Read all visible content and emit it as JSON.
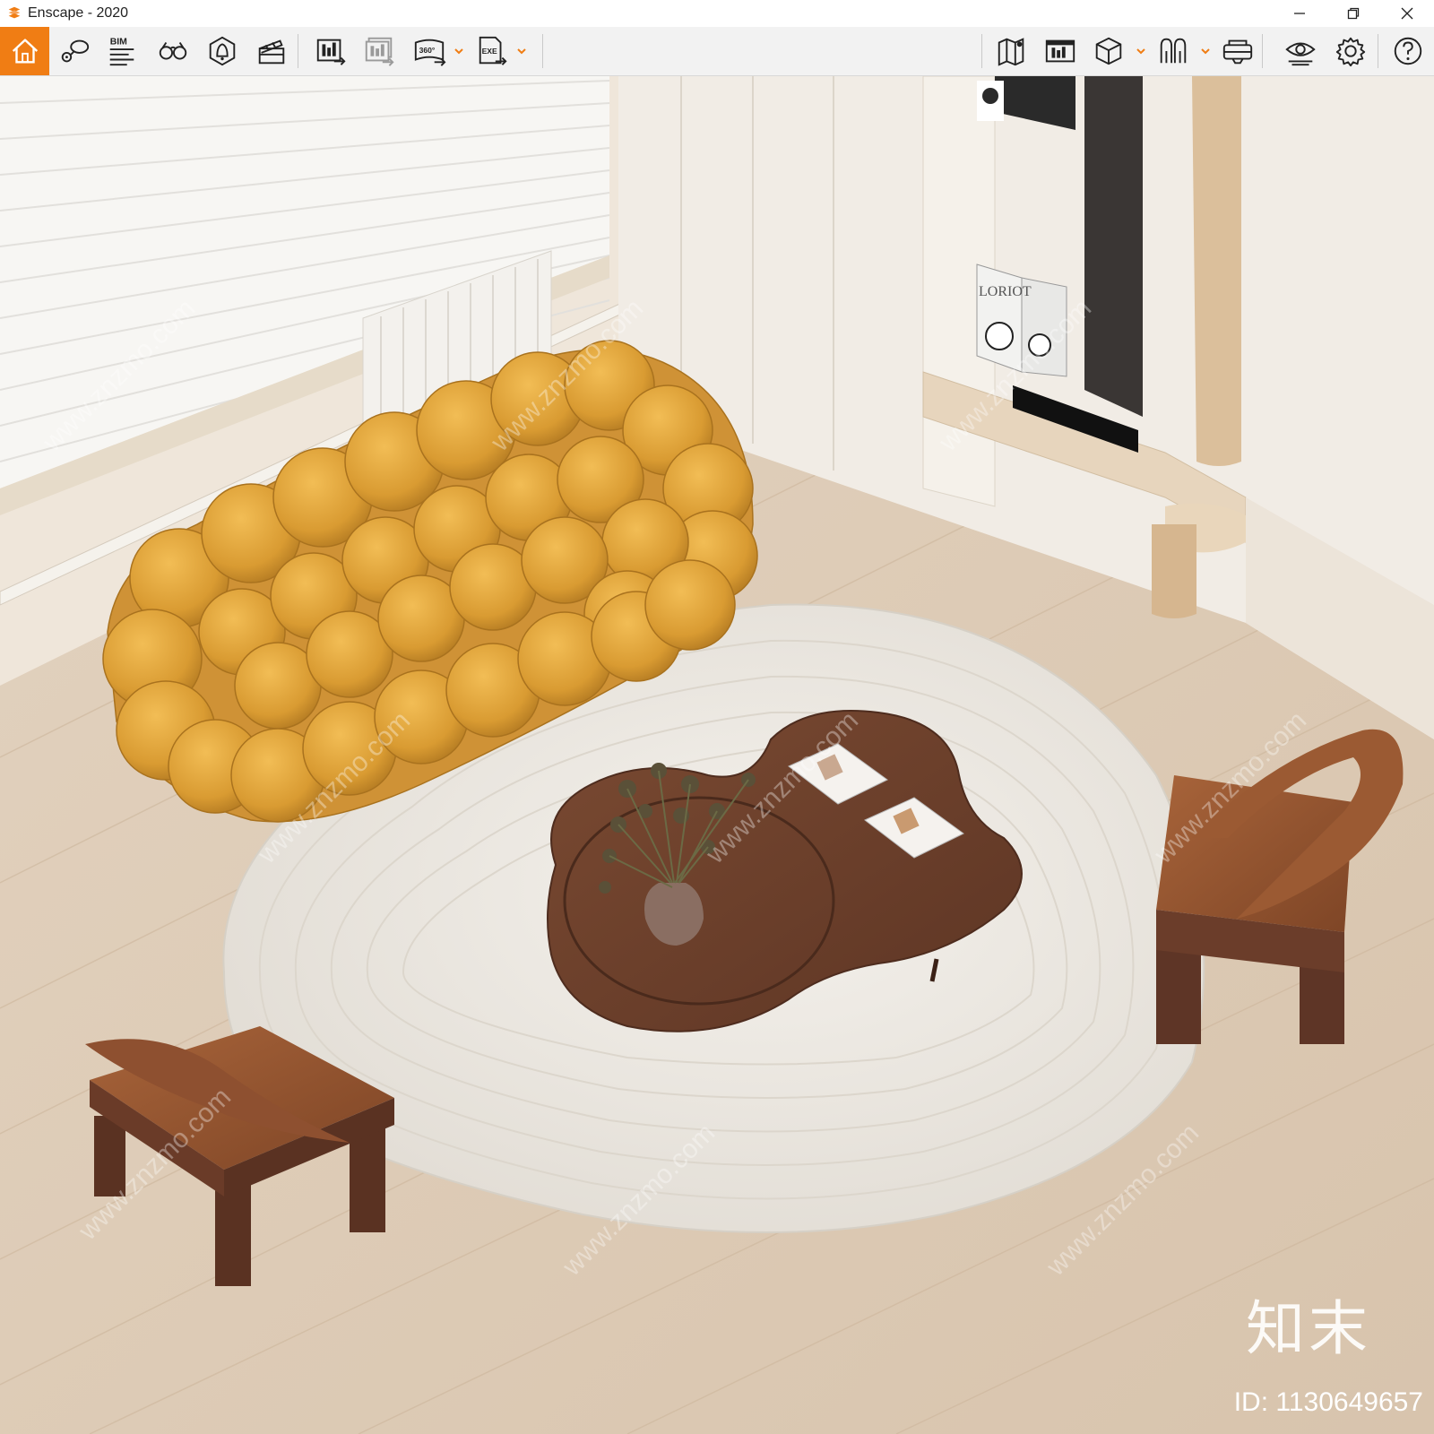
{
  "window": {
    "title": "Enscape - 2020",
    "accent_color": "#f07d14"
  },
  "toolbar": {
    "left_buttons": [
      {
        "icon": "home-icon"
      },
      {
        "icon": "pin-comment-icon"
      },
      {
        "icon": "bim-icon",
        "label": "BIM"
      },
      {
        "icon": "binoculars-icon"
      },
      {
        "icon": "atmosphere-bell-icon"
      },
      {
        "icon": "clapper-icon"
      },
      {
        "icon": "render-image-icon"
      },
      {
        "icon": "batch-render-icon"
      },
      {
        "icon": "render-360-icon",
        "label": "360°"
      },
      {
        "icon": "export-exe-icon",
        "label": "EXE"
      }
    ],
    "right_buttons": [
      {
        "icon": "map-icon"
      },
      {
        "icon": "asset-library-icon"
      },
      {
        "icon": "cube-icon"
      },
      {
        "icon": "vr-headset-icon"
      },
      {
        "icon": "eye-icon"
      },
      {
        "icon": "settings-icon"
      },
      {
        "icon": "help-icon"
      }
    ]
  },
  "viewport": {
    "watermark_text": "www.znzmo.com",
    "logo_text": "知末",
    "id_text": "ID: 1130649657",
    "book_title": "LORIOT"
  }
}
